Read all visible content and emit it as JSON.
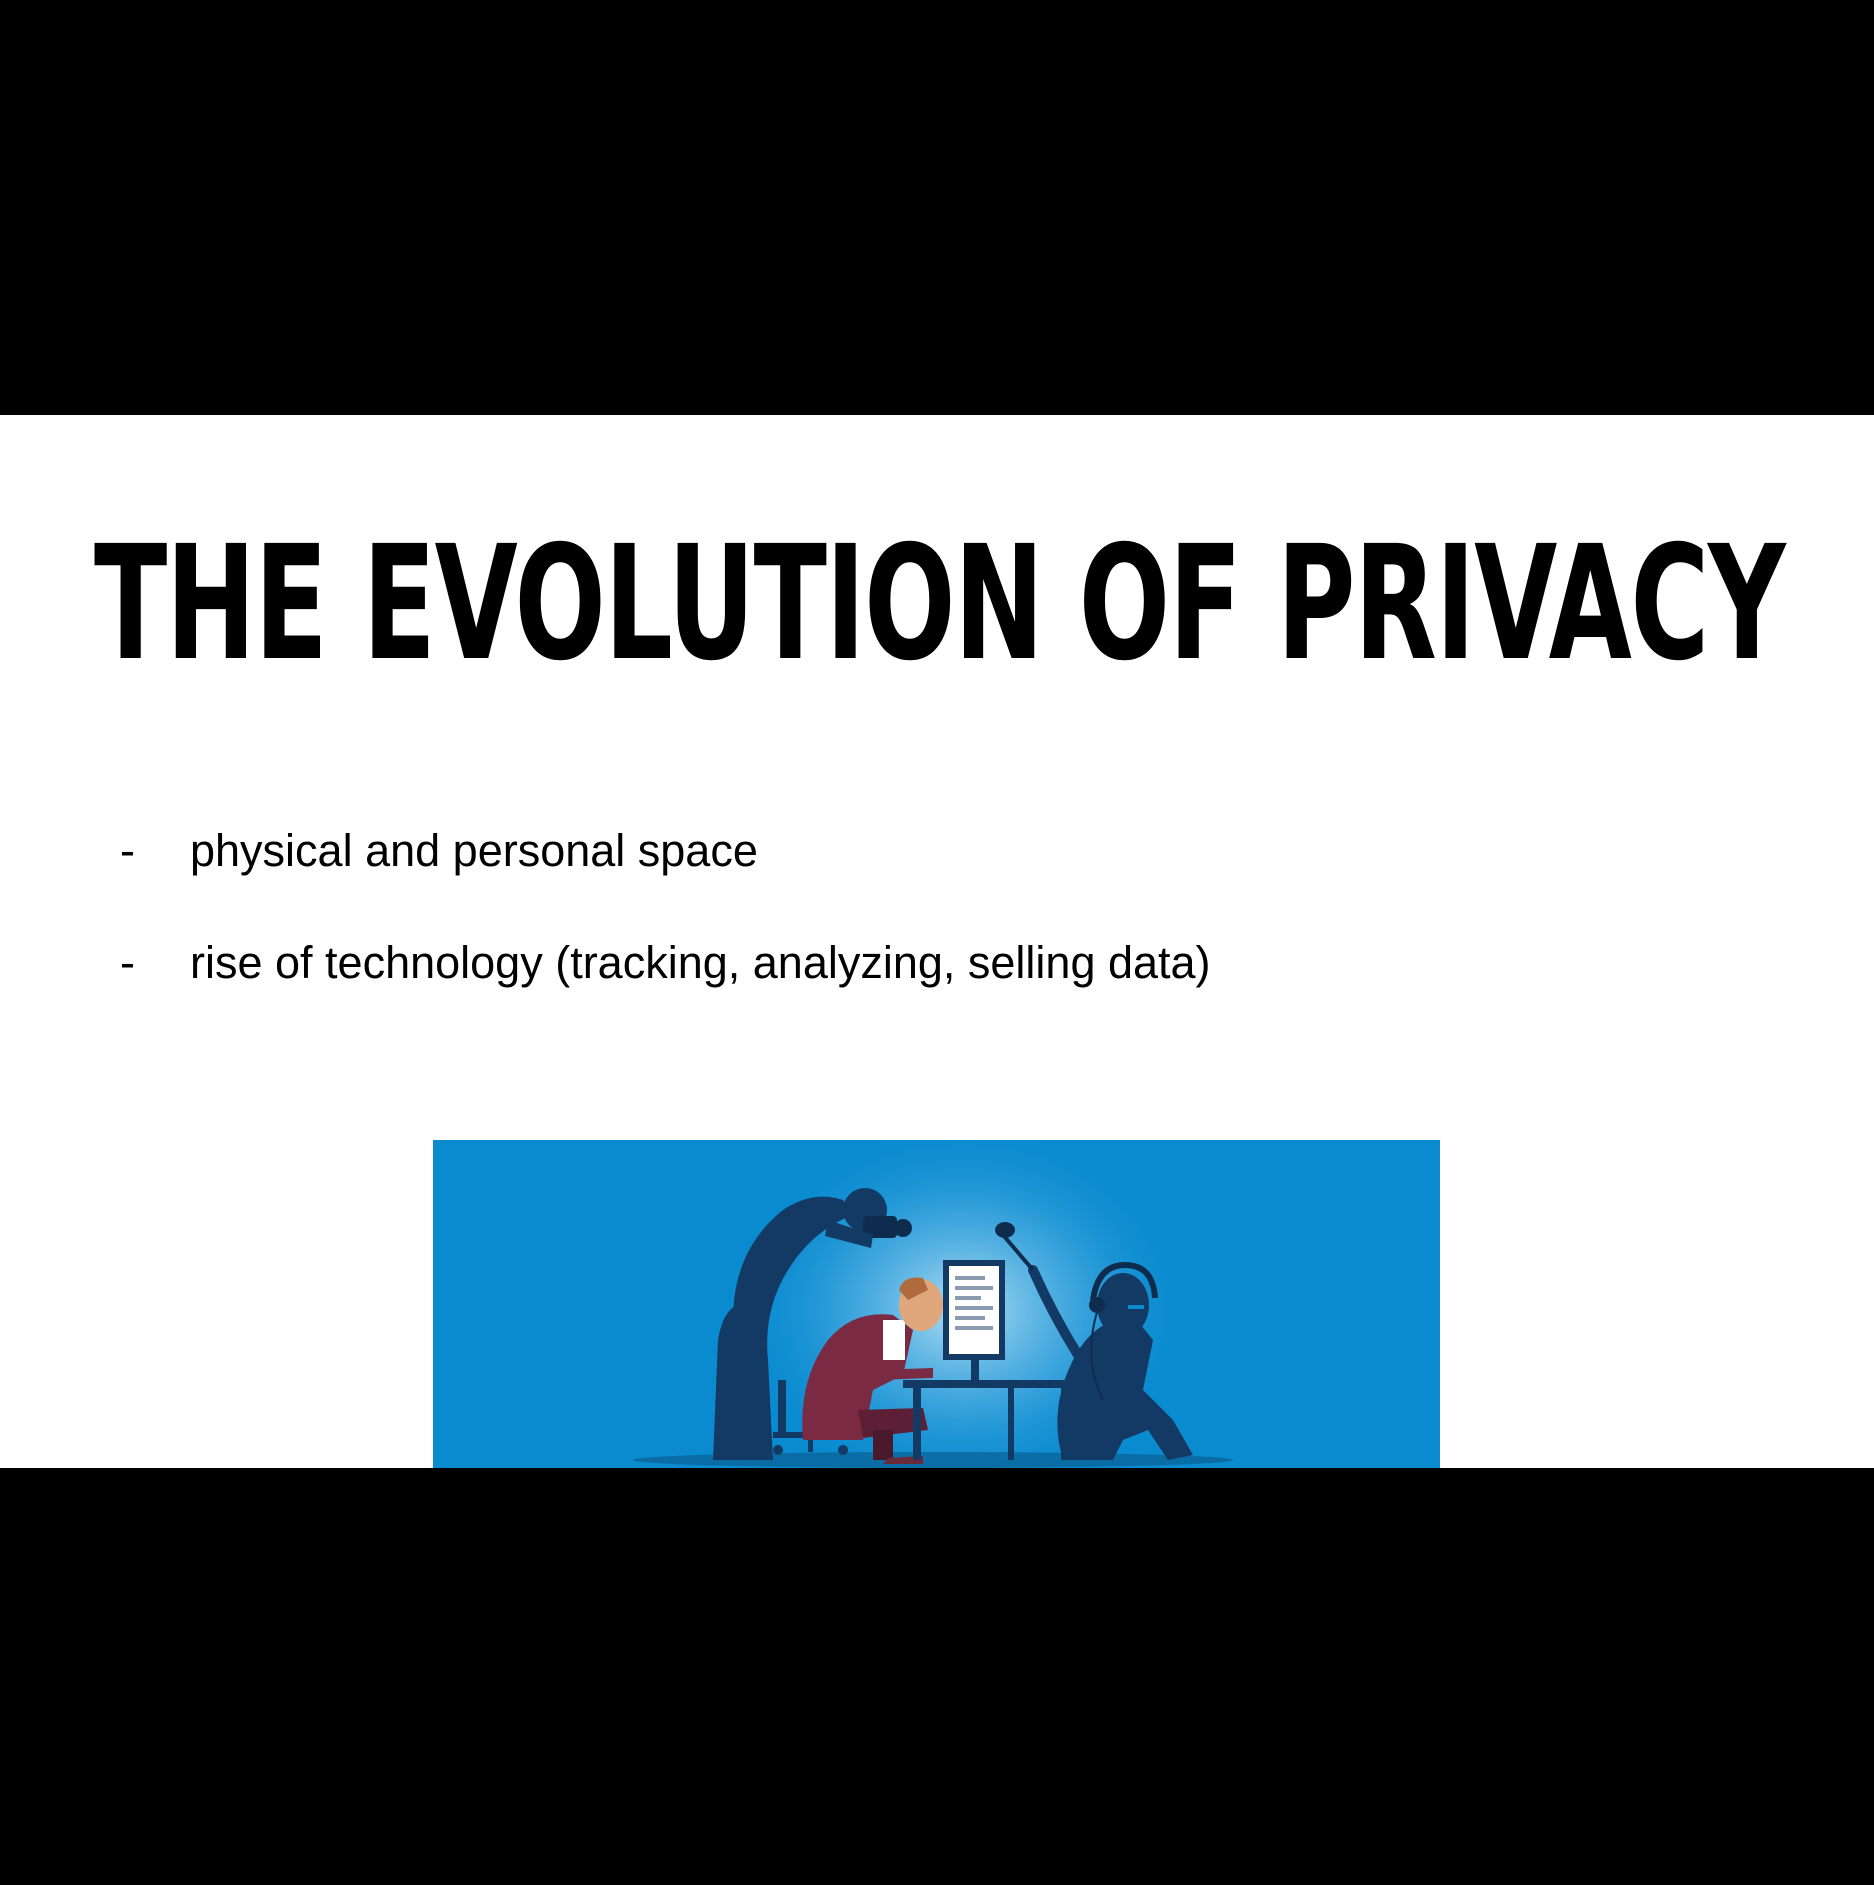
{
  "slide": {
    "title": "The Evolution of Privacy",
    "bullets": [
      {
        "marker": "-",
        "text": "physical and personal space"
      },
      {
        "marker": "-",
        "text": "rise of technology (tracking, analyzing, selling data)"
      }
    ]
  },
  "colors": {
    "background": "#ffffff",
    "letterbox": "#000000",
    "text": "#000000",
    "illustration_bg": "#0a8bd0"
  }
}
